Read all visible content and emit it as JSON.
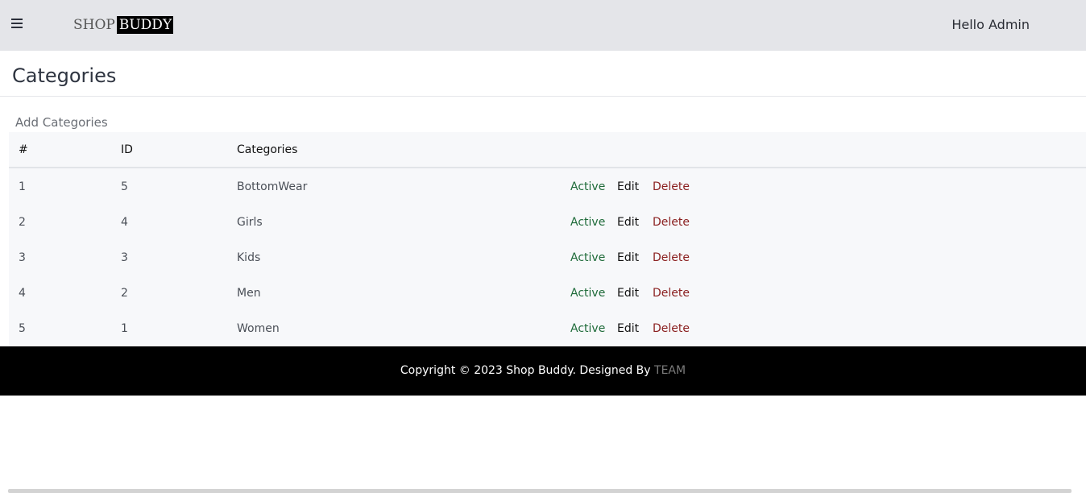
{
  "header": {
    "menu_icon": "hamburger-menu-icon",
    "logo_part1": "SHOP",
    "logo_part2": "BUDDY",
    "greeting": "Hello Admin"
  },
  "page": {
    "title": "Categories",
    "add_link": "Add Categories"
  },
  "table": {
    "headers": [
      "#",
      "ID",
      "Categories"
    ],
    "rows": [
      {
        "num": "1",
        "id": "5",
        "name": "BottomWear",
        "status": "Active",
        "edit": "Edit",
        "delete": "Delete"
      },
      {
        "num": "2",
        "id": "4",
        "name": "Girls",
        "status": "Active",
        "edit": "Edit",
        "delete": "Delete"
      },
      {
        "num": "3",
        "id": "3",
        "name": "Kids",
        "status": "Active",
        "edit": "Edit",
        "delete": "Delete"
      },
      {
        "num": "4",
        "id": "2",
        "name": "Men",
        "status": "Active",
        "edit": "Edit",
        "delete": "Delete"
      },
      {
        "num": "5",
        "id": "1",
        "name": "Women",
        "status": "Active",
        "edit": "Edit",
        "delete": "Delete"
      }
    ]
  },
  "footer": {
    "text": "Copyright © 2023 Shop Buddy. Designed By",
    "team_link": "TEAM"
  },
  "colors": {
    "topbar_bg": "#e4e5e9",
    "active": "#1f6b3a",
    "delete": "#8a1f1f",
    "footer_bg": "#000000"
  }
}
